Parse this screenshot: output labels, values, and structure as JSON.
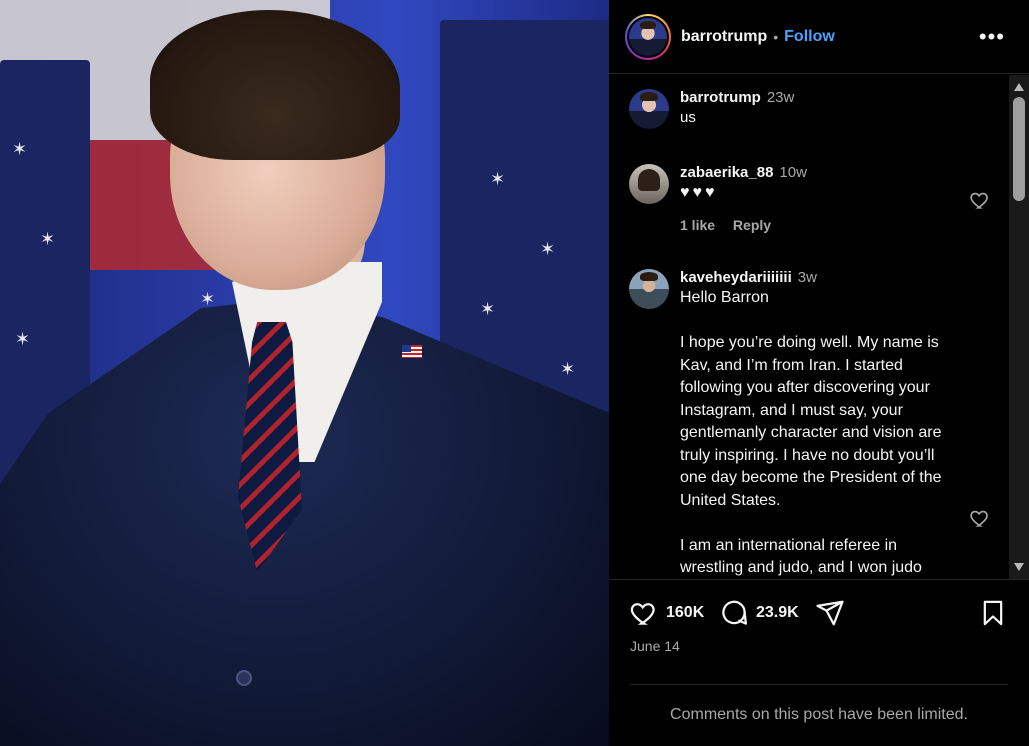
{
  "post": {
    "author": "barrotrump",
    "follow_label": "Follow",
    "separator": "•",
    "more_label": "•••",
    "likes": "160K",
    "comments_count": "23.9K",
    "date": "June 14",
    "limited_notice": "Comments on this post have been limited."
  },
  "caption": {
    "user": "barrotrump",
    "time": "23w",
    "text": "us"
  },
  "comments": [
    {
      "user": "zabaerika_88",
      "time": "10w",
      "text": "♥♥♥",
      "likes_label": "1 like",
      "reply_label": "Reply"
    },
    {
      "user": "kaveheydariiiiiii",
      "time": "3w",
      "text": "Hello Barron\n\nI hope you’re doing well. My name is Kav, and I’m from Iran. I started following you after discovering your Instagram, and I must say, your gentlemanly character and vision are truly inspiring. I have no doubt you’ll one day become the President of the United States.\n\nI am an international referee in wrestling and judo, and I won judo"
    }
  ],
  "icons": {
    "like": "heart-icon",
    "comment": "comment-icon",
    "share": "share-icon",
    "save": "bookmark-icon",
    "more": "more-options-icon"
  },
  "colors": {
    "accent": "#4aa3ff",
    "background": "#000000",
    "heart": "#ff3040",
    "secondary_text": "#a8a8a8"
  }
}
